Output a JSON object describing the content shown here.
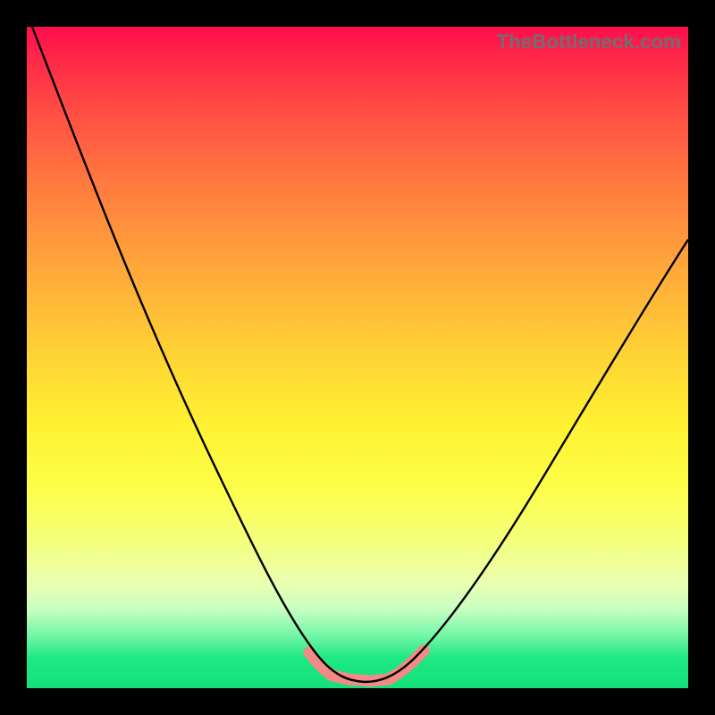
{
  "watermark": "TheBottleneck.com",
  "chart_data": {
    "type": "line",
    "title": "",
    "xlabel": "",
    "ylabel": "",
    "xlim": [
      0,
      100
    ],
    "ylim": [
      0,
      100
    ],
    "series": [
      {
        "name": "bottleneck-curve",
        "x": [
          0,
          10,
          20,
          30,
          35,
          40,
          44,
          48,
          52,
          56,
          60,
          70,
          80,
          90,
          100
        ],
        "y": [
          100,
          79,
          58,
          36,
          25,
          14,
          6,
          2,
          2,
          2,
          6,
          18,
          33,
          48,
          62
        ]
      }
    ],
    "highlights": [
      {
        "name": "left-marker",
        "x_range": [
          43,
          46
        ],
        "color": "#f48a84"
      },
      {
        "name": "base-marker",
        "x_range": [
          46,
          55
        ],
        "color": "#f48a84"
      },
      {
        "name": "right-marker",
        "x_range": [
          55,
          60
        ],
        "color": "#f48a84"
      }
    ],
    "background_gradient": [
      "#ff0d4e",
      "#ff7b3f",
      "#ffe832",
      "#fdff4a",
      "#1de884"
    ]
  }
}
